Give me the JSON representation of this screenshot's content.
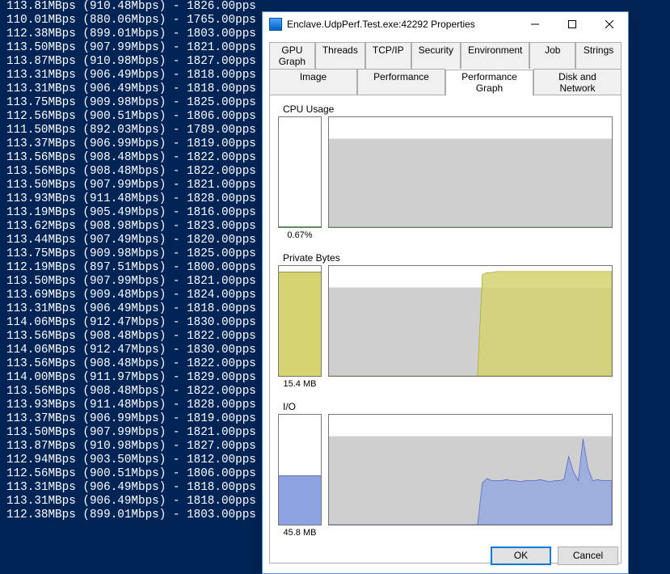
{
  "console_lines": [
    "113.81MBps (910.48Mbps) - 1826.00pps",
    "110.01MBps (880.06Mbps) - 1765.00pps",
    "112.38MBps (899.01Mbps) - 1803.00pps",
    "113.50MBps (907.99Mbps) - 1821.00pps",
    "113.87MBps (910.98Mbps) - 1827.00pps",
    "113.31MBps (906.49Mbps) - 1818.00pps",
    "113.31MBps (906.49Mbps) - 1818.00pps",
    "113.75MBps (909.98Mbps) - 1825.00pps",
    "112.56MBps (900.51Mbps) - 1806.00pps",
    "111.50MBps (892.03Mbps) - 1789.00pps",
    "113.37MBps (906.99Mbps) - 1819.00pps",
    "113.56MBps (908.48Mbps) - 1822.00pps",
    "113.56MBps (908.48Mbps) - 1822.00pps",
    "113.50MBps (907.99Mbps) - 1821.00pps",
    "113.93MBps (911.48Mbps) - 1828.00pps",
    "113.19MBps (905.49Mbps) - 1816.00pps",
    "113.62MBps (908.98Mbps) - 1823.00pps",
    "113.44MBps (907.49Mbps) - 1820.00pps",
    "113.75MBps (909.98Mbps) - 1825.00pps",
    "112.19MBps (897.51Mbps) - 1800.00pps",
    "113.50MBps (907.99Mbps) - 1821.00pps",
    "113.69MBps (909.48Mbps) - 1824.00pps",
    "113.31MBps (906.49Mbps) - 1818.00pps",
    "114.06MBps (912.47Mbps) - 1830.00pps",
    "113.56MBps (908.48Mbps) - 1822.00pps",
    "114.06MBps (912.47Mbps) - 1830.00pps",
    "113.56MBps (908.48Mbps) - 1822.00pps",
    "114.00MBps (911.97Mbps) - 1829.00pps",
    "113.56MBps (908.48Mbps) - 1822.00pps",
    "113.93MBps (911.48Mbps) - 1828.00pps",
    "113.37MBps (906.99Mbps) - 1819.00pps",
    "113.50MBps (907.99Mbps) - 1821.00pps",
    "113.87MBps (910.98Mbps) - 1827.00pps",
    "112.94MBps (903.50Mbps) - 1812.00pps",
    "112.56MBps (900.51Mbps) - 1806.00pps",
    "113.31MBps (906.49Mbps) - 1818.00pps",
    "113.31MBps (906.49Mbps) - 1818.00pps",
    "112.38MBps (899.01Mbps) - 1803.00pps"
  ],
  "dialog": {
    "title": "Enclave.UdpPerf.Test.exe:42292 Properties",
    "tabs_row1": [
      "GPU Graph",
      "Threads",
      "TCP/IP",
      "Security",
      "Environment",
      "Job",
      "Strings"
    ],
    "tabs_row2": [
      "Image",
      "Performance",
      "Performance Graph",
      "Disk and Network"
    ],
    "active_tab": "Performance Graph",
    "ok": "OK",
    "cancel": "Cancel"
  },
  "sections": {
    "cpu": {
      "title": "CPU Usage",
      "value": "0.67%",
      "fill_pct": 1,
      "color": "#6fdc6f"
    },
    "bytes": {
      "title": "Private Bytes",
      "value": "15.4 MB",
      "fill_pct": 95,
      "color": "#d4d36f"
    },
    "io": {
      "title": "I/O",
      "value": "45.8  MB",
      "fill_pct": 45,
      "color": "#8ea4e2"
    }
  },
  "chart_data": [
    {
      "type": "area",
      "title": "CPU Usage history",
      "ylim_pct": [
        0,
        100
      ],
      "series": [
        {
          "name": "CPU",
          "values_pct": [
            0,
            0,
            0,
            0,
            0,
            0,
            0,
            0,
            0,
            0,
            0,
            0,
            0,
            0,
            0,
            0,
            0,
            0,
            0,
            0,
            0,
            0,
            0,
            0,
            0,
            0,
            0,
            0,
            0,
            0,
            0,
            0,
            0,
            0,
            0,
            0,
            0,
            0,
            0,
            0,
            0,
            0,
            0,
            0,
            0,
            0,
            0,
            0,
            0,
            0,
            0,
            0,
            0,
            0,
            0,
            0,
            0,
            0,
            0,
            0
          ]
        }
      ]
    },
    {
      "type": "area",
      "title": "Private Bytes history",
      "ylim_pct": [
        0,
        100
      ],
      "series": [
        {
          "name": "Private Bytes",
          "values_pct": [
            0,
            0,
            0,
            0,
            0,
            0,
            0,
            0,
            0,
            0,
            0,
            0,
            0,
            0,
            0,
            0,
            0,
            0,
            0,
            0,
            0,
            0,
            0,
            0,
            0,
            0,
            0,
            0,
            0,
            0,
            0,
            0,
            92,
            94,
            94,
            95,
            95,
            95,
            95,
            95,
            95,
            95,
            95,
            95,
            95,
            95,
            95,
            95,
            95,
            95,
            95,
            95,
            95,
            95,
            95,
            95,
            95,
            95,
            95,
            95
          ]
        }
      ]
    },
    {
      "type": "area",
      "title": "I/O history",
      "ylim_pct": [
        0,
        100
      ],
      "series": [
        {
          "name": "I/O",
          "values_pct": [
            0,
            0,
            0,
            0,
            0,
            0,
            0,
            0,
            0,
            0,
            0,
            0,
            0,
            0,
            0,
            0,
            0,
            0,
            0,
            0,
            0,
            0,
            0,
            0,
            0,
            0,
            0,
            0,
            0,
            0,
            0,
            0,
            38,
            42,
            40,
            40,
            40,
            41,
            40,
            40,
            39,
            40,
            40,
            40,
            41,
            40,
            39,
            40,
            40,
            41,
            62,
            48,
            40,
            78,
            52,
            40,
            41,
            40,
            40,
            40
          ]
        }
      ]
    }
  ]
}
